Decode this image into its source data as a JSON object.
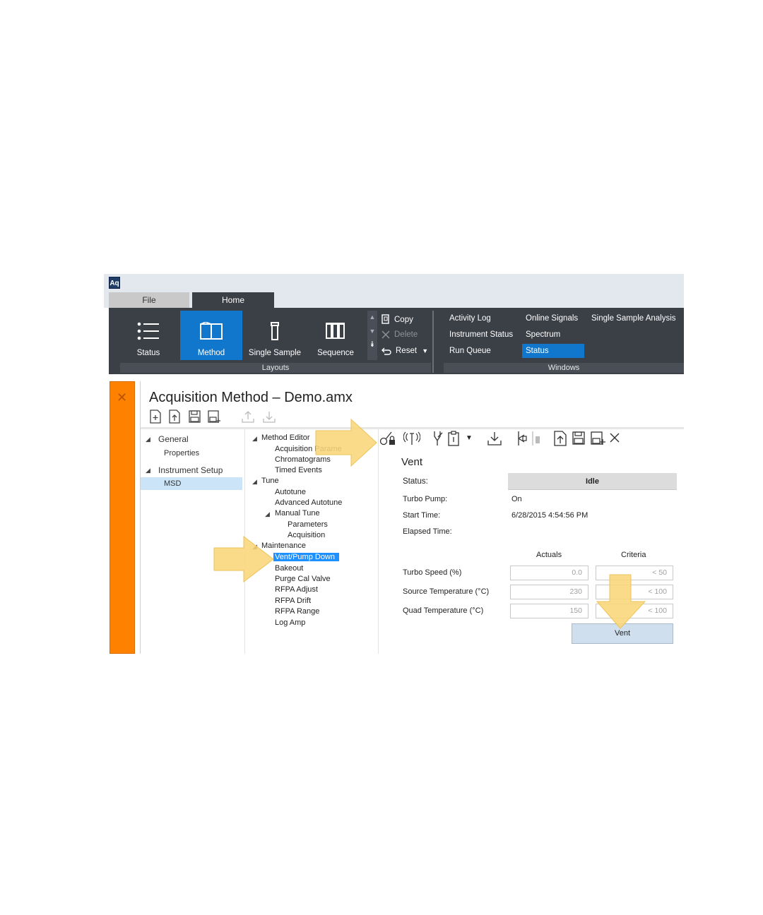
{
  "app": {
    "logo_text": "Aq"
  },
  "tabs": {
    "file": "File",
    "home": "Home"
  },
  "ribbon": {
    "layouts": [
      {
        "label": "Status",
        "icon": "list-icon"
      },
      {
        "label": "Method",
        "icon": "method-icon",
        "selected": true
      },
      {
        "label": "Single Sample",
        "icon": "vial-icon"
      },
      {
        "label": "Sequence",
        "icon": "sequence-icon"
      }
    ],
    "layouts_group_label": "Layouts",
    "commands": {
      "copy": "Copy",
      "delete": "Delete",
      "reset": "Reset"
    },
    "windows": {
      "activity_log": "Activity Log",
      "instrument_status": "Instrument Status",
      "run_queue": "Run Queue",
      "online_signals": "Online Signals",
      "spectrum": "Spectrum",
      "status": "Status",
      "single_sample_analysis": "Single Sample Analysis"
    },
    "windows_group_label": "Windows"
  },
  "document": {
    "title": "Acquisition Method – Demo.amx"
  },
  "left_nav": {
    "general": "General",
    "properties": "Properties",
    "instrument_setup": "Instrument Setup",
    "msd": "MSD"
  },
  "tree": {
    "method_editor": "Method Editor",
    "acquisition_params": "Acquisition Parame",
    "chromatograms": "Chromatograms",
    "timed_events": "Timed Events",
    "tune": "Tune",
    "autotune": "Autotune",
    "advanced_autotune": "Advanced Autotune",
    "manual_tune": "Manual Tune",
    "parameters": "Parameters",
    "acquisition": "Acquisition",
    "maintenance": "Maintenance",
    "vent_pump_down": "Vent/Pump Down",
    "bakeout": "Bakeout",
    "purge_cal_valve": "Purge Cal Valve",
    "rfpa_adjust": "RFPA Adjust",
    "rfpa_drift": "RFPA Drift",
    "rfpa_range": "RFPA Range",
    "log_amp": "Log Amp"
  },
  "vent": {
    "heading": "Vent",
    "status_label": "Status:",
    "status_value": "Idle",
    "turbo_pump_label": "Turbo Pump:",
    "turbo_pump_value": "On",
    "start_time_label": "Start Time:",
    "start_time_value": "6/28/2015 4:54:56 PM",
    "elapsed_time_label": "Elapsed Time:",
    "actuals_header": "Actuals",
    "criteria_header": "Criteria",
    "rows": [
      {
        "label": "Turbo Speed (%)",
        "actual": "0.0",
        "criteria": "< 50"
      },
      {
        "label": "Source Temperature (°C)",
        "actual": "230",
        "criteria": "< 100"
      },
      {
        "label": "Quad Temperature (°C)",
        "actual": "150",
        "criteria": "< 100"
      }
    ],
    "vent_button": "Vent"
  },
  "colors": {
    "accent": "#1177cc",
    "orange_pane": "#fe8200",
    "ribbon": "#3b3f46",
    "callout_arrow": "#f9d67a"
  }
}
